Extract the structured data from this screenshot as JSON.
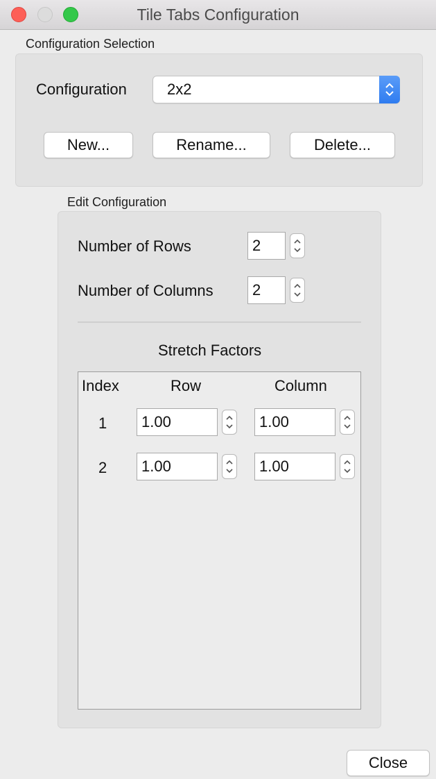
{
  "window": {
    "title": "Tile Tabs Configuration"
  },
  "config_selection": {
    "group_label": "Configuration Selection",
    "label": "Configuration",
    "selected": "2x2",
    "buttons": {
      "new": "New...",
      "rename": "Rename...",
      "delete": "Delete..."
    }
  },
  "edit": {
    "group_label": "Edit Configuration",
    "rows_label": "Number of Rows",
    "rows_value": "2",
    "cols_label": "Number of Columns",
    "cols_value": "2",
    "stretch_title": "Stretch Factors",
    "headers": {
      "index": "Index",
      "row": "Row",
      "column": "Column"
    },
    "rows": [
      {
        "index": "1",
        "row": "1.00",
        "column": "1.00"
      },
      {
        "index": "2",
        "row": "1.00",
        "column": "1.00"
      }
    ]
  },
  "close_label": "Close",
  "colors": {
    "accent": "#2f7cf0",
    "close": "#fd5f57",
    "zoom": "#34c84a"
  }
}
